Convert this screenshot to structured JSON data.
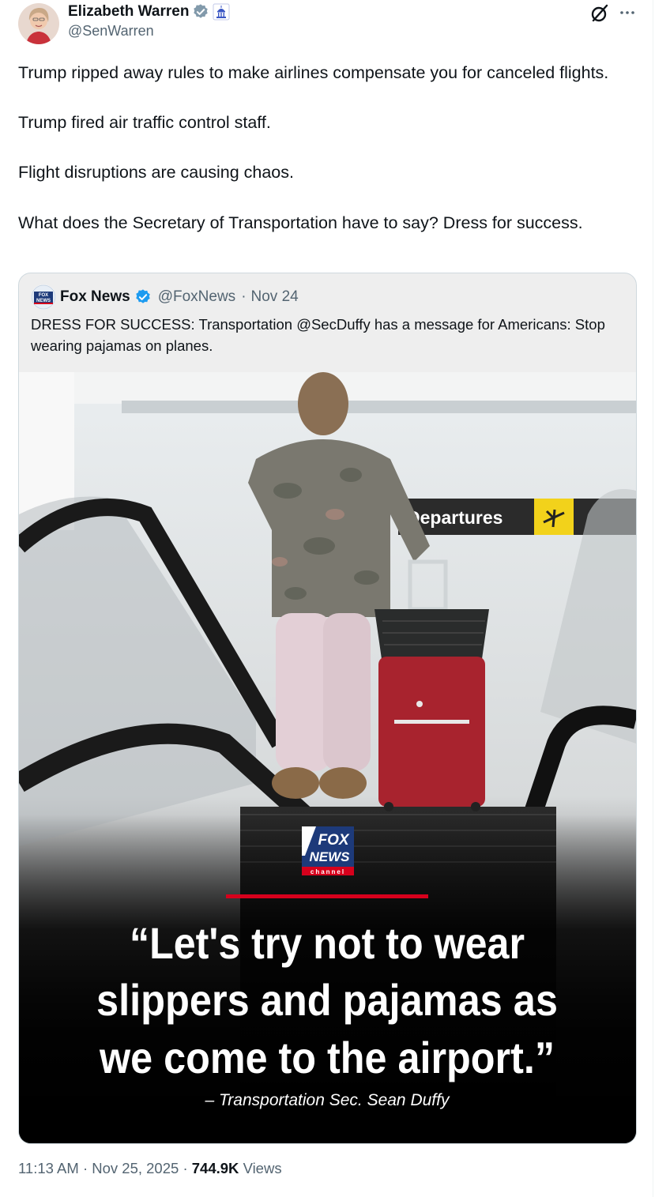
{
  "author": {
    "name": "Elizabeth Warren",
    "handle": "@SenWarren"
  },
  "post": {
    "paragraphs": [
      "Trump ripped away rules to make airlines compensate you for canceled flights.",
      "Trump fired air traffic control staff.",
      "Flight disruptions are causing chaos.",
      "What does the Secretary of Transportation have to say? Dress for success."
    ]
  },
  "quote": {
    "name": "Fox News",
    "handle": "@FoxNews",
    "separator": "·",
    "date": "Nov 24",
    "text": "DRESS FOR SUCCESS: Transportation @SecDuffy has a message for Americans: Stop wearing pajamas on planes.",
    "image": {
      "sign_text": "Departures",
      "logo_top": "FOX",
      "logo_bottom": "NEWS",
      "logo_channel": "channel",
      "quote_line1": "“Let's try not to wear",
      "quote_line2": "slippers and pajamas as",
      "quote_line3": "we come to the airport.”",
      "attribution": "– Transportation Sec. Sean Duffy"
    }
  },
  "meta": {
    "time": "11:13 AM",
    "date": "Nov 25, 2025",
    "separator": "·",
    "views_count": "744.9K",
    "views_label": "Views"
  },
  "colors": {
    "verified_blue": "#1d9bf0",
    "gov_gray": "#829aab",
    "fox_red": "#d6001c",
    "sign_yellow": "#f2d21b"
  },
  "icons": {
    "grok": "grok-icon",
    "more": "more-icon"
  }
}
